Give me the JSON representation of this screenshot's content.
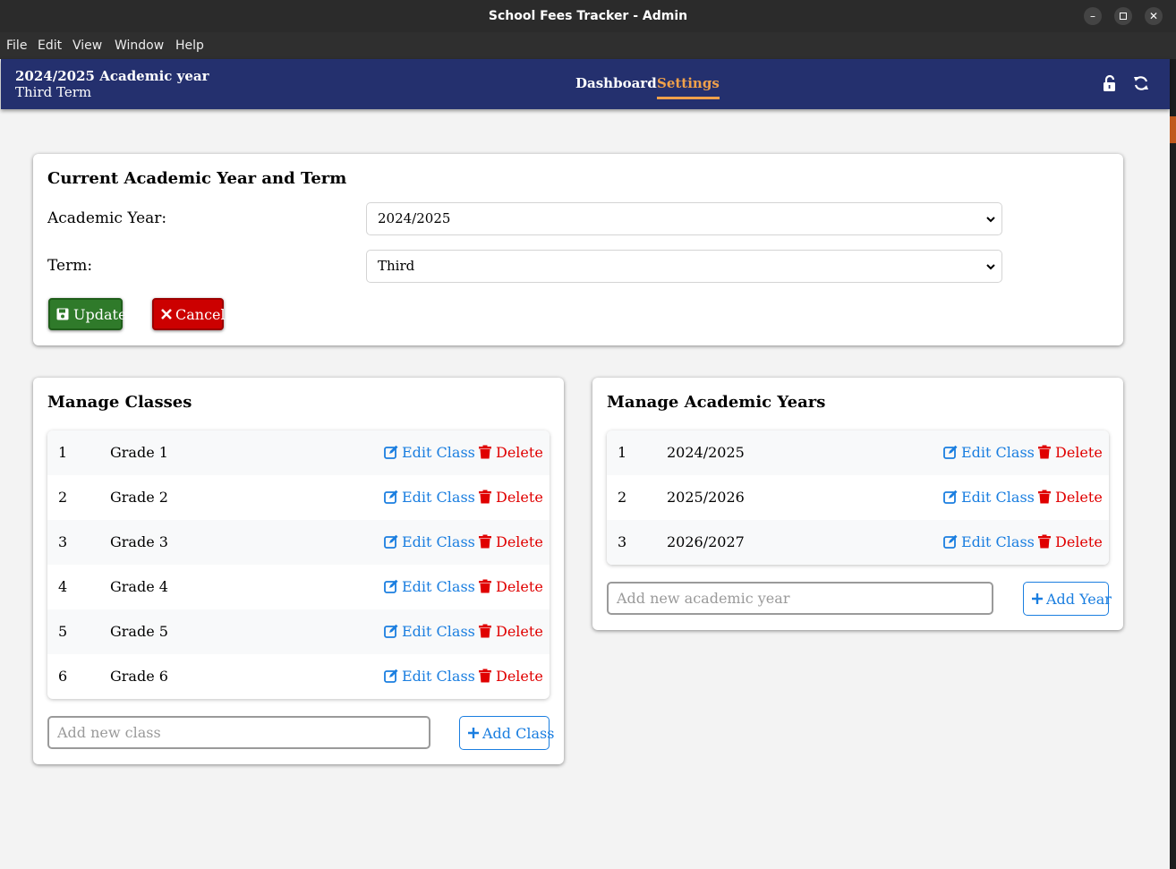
{
  "window": {
    "title": "School Fees Tracker - Admin"
  },
  "menu": [
    "File",
    "Edit",
    "View",
    "Window",
    "Help"
  ],
  "header": {
    "year": "2024/2025 Academic year",
    "term": "Third Term",
    "nav": {
      "dashboard": "Dashboard",
      "settings": "Settings"
    },
    "active_nav": "Settings"
  },
  "current": {
    "title": "Current Academic Year and Term",
    "year_label": "Academic Year:",
    "year_value": "2024/2025",
    "term_label": "Term:",
    "term_value": "Third",
    "update_label": "Update",
    "cancel_label": "Cancel"
  },
  "classes": {
    "title": "Manage Classes",
    "items": [
      {
        "num": "1",
        "name": "Grade 1",
        "edit": "Edit Class",
        "delete": "Delete"
      },
      {
        "num": "2",
        "name": "Grade 2",
        "edit": "Edit Class",
        "delete": "Delete"
      },
      {
        "num": "3",
        "name": "Grade 3",
        "edit": "Edit Class",
        "delete": "Delete"
      },
      {
        "num": "4",
        "name": "Grade 4",
        "edit": "Edit Class",
        "delete": "Delete"
      },
      {
        "num": "5",
        "name": "Grade 5",
        "edit": "Edit Class",
        "delete": "Delete"
      },
      {
        "num": "6",
        "name": "Grade 6",
        "edit": "Edit Class",
        "delete": "Delete"
      }
    ],
    "add_placeholder": "Add new class",
    "add_label": "Add Class"
  },
  "years": {
    "title": "Manage Academic Years",
    "items": [
      {
        "num": "1",
        "name": "2024/2025",
        "edit": "Edit Class",
        "delete": "Delete"
      },
      {
        "num": "2",
        "name": "2025/2026",
        "edit": "Edit Class",
        "delete": "Delete"
      },
      {
        "num": "3",
        "name": "2026/2027",
        "edit": "Edit Class",
        "delete": "Delete"
      }
    ],
    "add_placeholder": "Add new academic year",
    "add_label": "Add Year"
  },
  "colors": {
    "header_bg": "#24306e",
    "accent": "#f0a14a",
    "link": "#1a7ee0",
    "danger": "#e00000",
    "success": "#2f7a2a"
  }
}
